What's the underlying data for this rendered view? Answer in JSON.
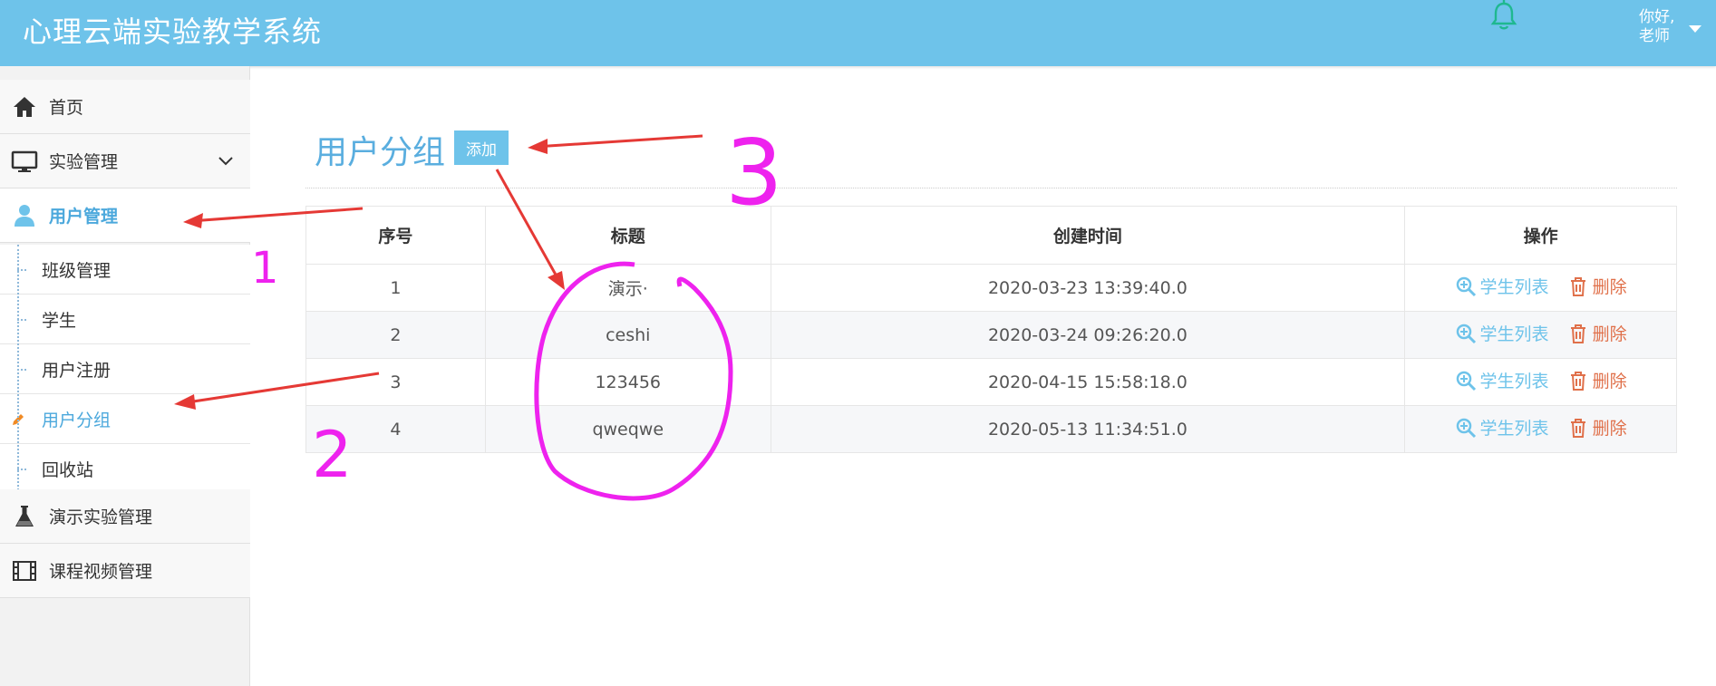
{
  "header": {
    "app_title": "心理云端实验教学系统",
    "greeting_line1": "你好,",
    "greeting_line2": "老师"
  },
  "sidebar": {
    "items": [
      {
        "label": "首页",
        "icon": "home-icon"
      },
      {
        "label": "实验管理",
        "icon": "monitor-icon"
      },
      {
        "label": "用户管理",
        "icon": "user-icon"
      },
      {
        "label": "演示实验管理",
        "icon": "flask-icon"
      },
      {
        "label": "课程视频管理",
        "icon": "film-icon"
      }
    ],
    "subitems": [
      {
        "label": "班级管理"
      },
      {
        "label": "学生"
      },
      {
        "label": "用户注册"
      },
      {
        "label": "用户分组",
        "icon": "pencil-icon"
      },
      {
        "label": "回收站"
      }
    ]
  },
  "main": {
    "title": "用户分组",
    "add_label": "添加",
    "columns": [
      "序号",
      "标题",
      "创建时间",
      "操作"
    ],
    "rows": [
      {
        "index": "1",
        "title": "演示·",
        "created": "2020-03-23 13:39:40.0"
      },
      {
        "index": "2",
        "title": "ceshi",
        "created": "2020-03-24 09:26:20.0"
      },
      {
        "index": "3",
        "title": "123456",
        "created": "2020-04-15 15:58:18.0"
      },
      {
        "index": "4",
        "title": "qweqwe",
        "created": "2020-05-13 11:34:51.0"
      }
    ],
    "action_list_label": "学生列表",
    "action_delete_label": "删除"
  },
  "annotations": {
    "numbers": [
      "1",
      "2",
      "3"
    ]
  },
  "colors": {
    "header_bg": "#6ec3ea",
    "accent": "#4ba8dc",
    "delete": "#e0704a",
    "annotation_arrow": "#e53935",
    "annotation_ink": "#ee22ee"
  }
}
